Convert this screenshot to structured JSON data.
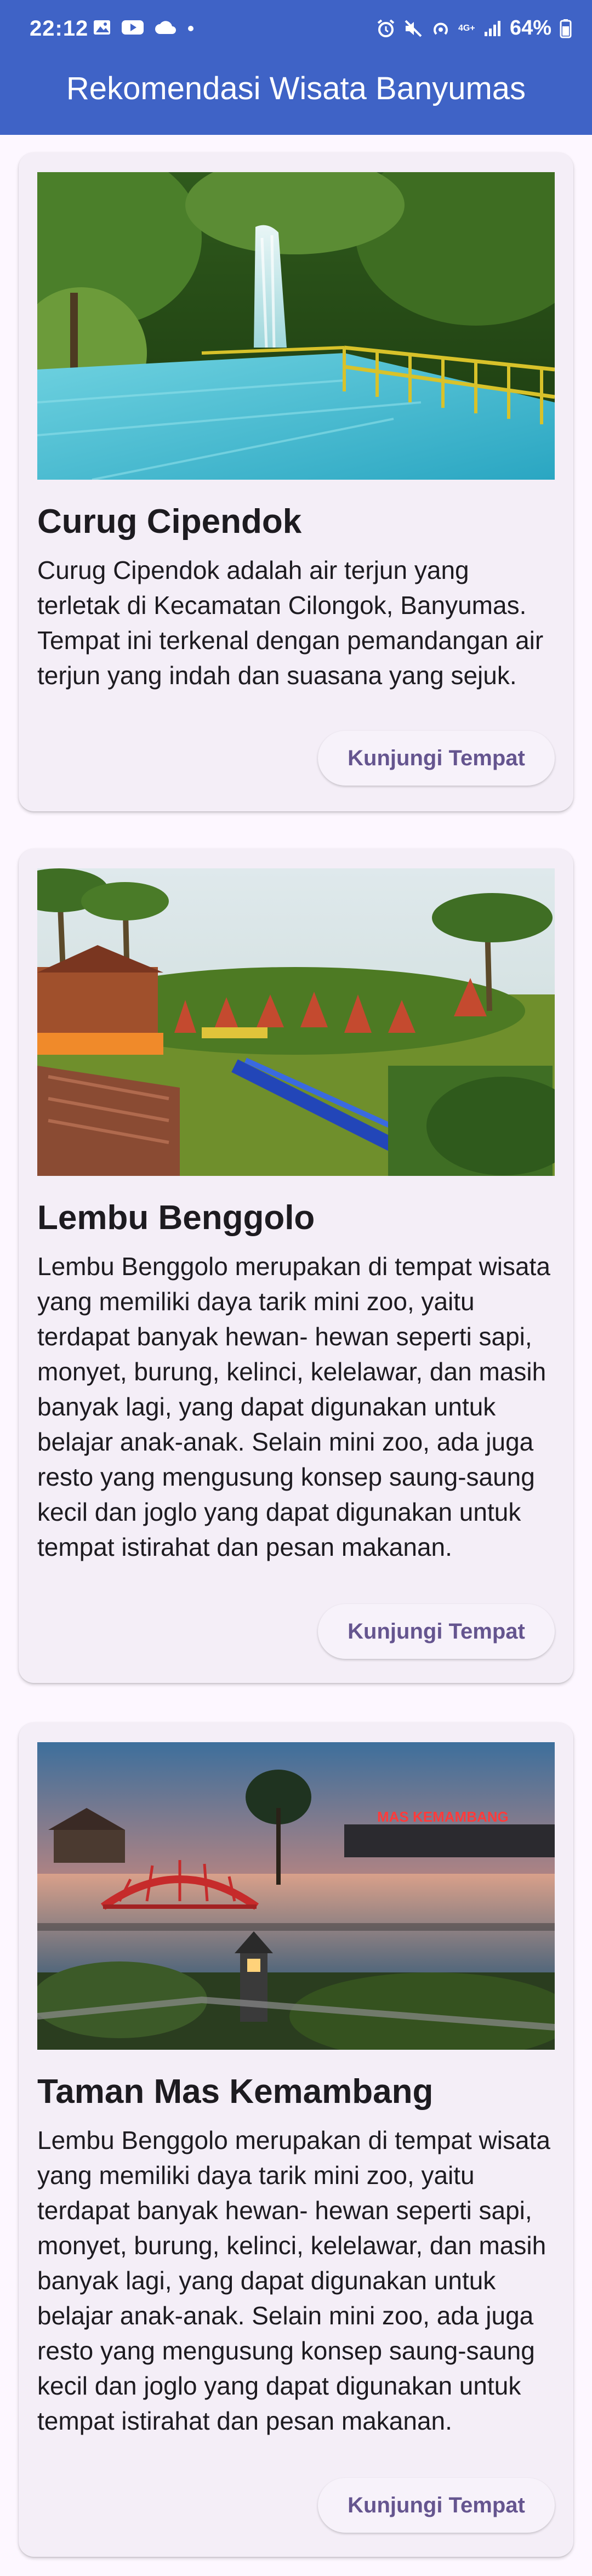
{
  "status_bar": {
    "time": "22:12",
    "battery": "64%",
    "network": "4G+",
    "icons": [
      "image-icon",
      "youtube-icon",
      "cloud-icon",
      "dot-icon",
      "alarm-icon",
      "mute-icon",
      "hotspot-icon",
      "signal-icon",
      "battery-icon"
    ]
  },
  "app_bar": {
    "title": "Rekomendasi Wisata Banyumas"
  },
  "colors": {
    "app_bar": "#3f63c6",
    "card": "#f4eef7",
    "button_text": "#65558f",
    "background": "#fdf7ff"
  },
  "places": [
    {
      "name": "Curug Cipendok",
      "description": "Curug Cipendok adalah air terjun yang terletak di Kecamatan Cilongok, Banyumas. Tempat ini terkenal dengan pemandangan air terjun yang indah dan suasana yang sejuk.",
      "button": "Kunjungi Tempat"
    },
    {
      "name": "Lembu Benggolo",
      "description": "Lembu Benggolo merupakan di tempat wisata  yang memiliki daya tarik mini zoo, yaitu terdapat banyak hewan- hewan  seperti sapi, monyet, burung, kelinci, kelelawar, dan masih banyak lagi, yang dapat digunakan untuk belajar anak-anak. Selain mini zoo, ada juga resto yang mengusung konsep saung-saung kecil dan joglo yang dapat digunakan untuk tempat istirahat dan pesan makanan.",
      "button": "Kunjungi Tempat"
    },
    {
      "name": "Taman Mas Kemambang",
      "description": "Lembu Benggolo merupakan di tempat wisata  yang memiliki daya tarik mini zoo, yaitu terdapat banyak hewan- hewan  seperti sapi, monyet, burung, kelinci, kelelawar, dan masih banyak lagi, yang dapat digunakan untuk belajar anak-anak. Selain mini zoo, ada juga resto yang mengusung konsep saung-saung kecil dan joglo yang dapat digunakan untuk tempat istirahat dan pesan makanan.",
      "button": "Kunjungi Tempat",
      "image_sign": "MAS KEMAMBANG"
    }
  ]
}
